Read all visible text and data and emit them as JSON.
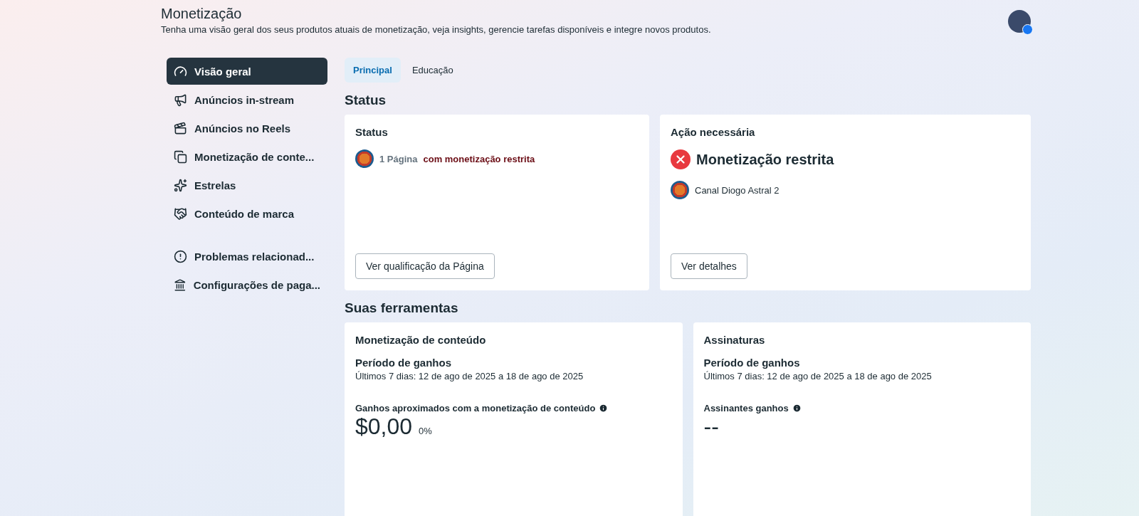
{
  "header": {
    "title": "Monetização",
    "subtitle": "Tenha uma visão geral dos seus produtos atuais de monetização, veja insights, gerencie tarefas disponíveis e integre novos produtos."
  },
  "sidebar": {
    "groups": [
      [
        {
          "label": "Visão geral",
          "selected": true
        },
        {
          "label": "Anúncios in-stream",
          "selected": false
        },
        {
          "label": "Anúncios no Reels",
          "selected": false
        },
        {
          "label": "Monetização de conte...",
          "selected": false
        },
        {
          "label": "Estrelas",
          "selected": false
        },
        {
          "label": "Conteúdo de marca",
          "selected": false
        }
      ],
      [
        {
          "label": "Problemas relacionad...",
          "selected": false
        },
        {
          "label": "Configurações de paga...",
          "selected": false
        }
      ]
    ]
  },
  "tabs": [
    {
      "label": "Principal",
      "selected": true
    },
    {
      "label": "Educação",
      "selected": false
    }
  ],
  "status_section": {
    "heading": "Status",
    "status_card": {
      "title": "Status",
      "count": "1 Página",
      "text": "com monetização restrita",
      "button": "Ver qualificação da Página"
    },
    "action_card": {
      "title": "Ação necessária",
      "headline": "Monetização restrita",
      "page_name": "Canal Diogo Astral 2",
      "button": "Ver detalhes"
    }
  },
  "tools_section": {
    "heading": "Suas ferramentas",
    "cards": [
      {
        "title": "Monetização de conteúdo",
        "period_title": "Período de ganhos",
        "period": "Últimos 7 dias: 12 de ago de 2025 a 18 de ago de 2025",
        "metric_label": "Ganhos aproximados com a monetização de conteúdo",
        "value": "$0,00",
        "change": "0%"
      },
      {
        "title": "Assinaturas",
        "period_title": "Período de ganhos",
        "period": "Últimos 7 dias: 12 de ago de 2025 a 18 de ago de 2025",
        "metric_label": "Assinantes ganhos",
        "value": "--"
      }
    ]
  }
}
